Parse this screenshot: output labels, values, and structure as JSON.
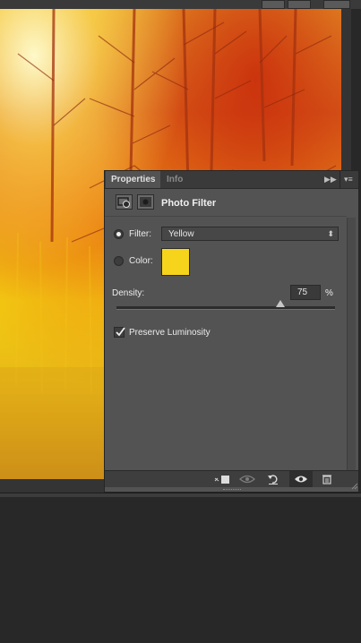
{
  "panel": {
    "tabs": [
      {
        "label": "Properties"
      },
      {
        "label": "Info"
      }
    ],
    "header": {
      "adjustment_icon": "adjustment-layer-icon",
      "mask_icon": "layer-mask-icon",
      "title": "Photo Filter"
    },
    "filter": {
      "label": "Filter:",
      "value": "Yellow",
      "selected": true
    },
    "color": {
      "label": "Color:",
      "swatch": "#f7d41c",
      "selected": false
    },
    "density": {
      "label": "Density:",
      "value": "75",
      "unit": "%",
      "slider_fraction": 0.75
    },
    "preserve_luminosity": {
      "label": "Preserve Luminosity",
      "checked": true
    },
    "footer_icons": [
      "clip-to-layer-icon",
      "view-previous-state-icon",
      "reset-adjustments-icon",
      "toggle-visibility-icon",
      "delete-adjustment-icon"
    ]
  },
  "colors": {
    "panel_bg": "#535353",
    "tab_bar_bg": "#3a3a3a",
    "app_bg": "#282828",
    "swatch": "#f7d41c"
  }
}
